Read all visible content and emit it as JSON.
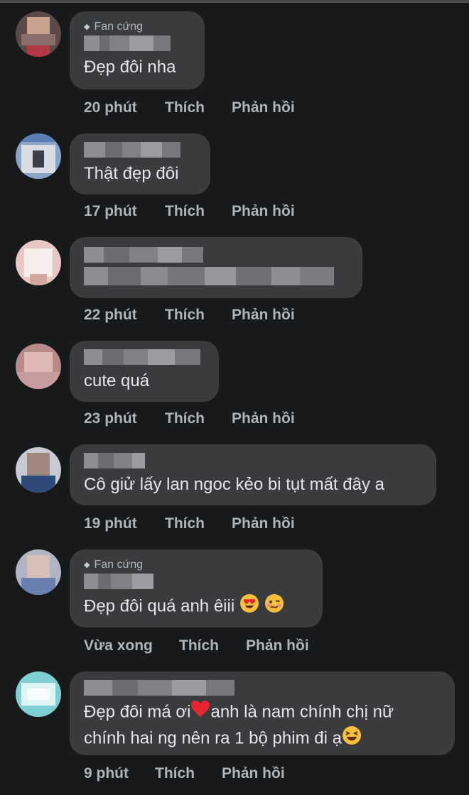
{
  "comments": [
    {
      "badge": "Fan cứng",
      "text": "Đẹp đôi nha",
      "time": "20 phút",
      "like": "Thích",
      "reply": "Phản hồi"
    },
    {
      "badge": "",
      "text": "Thật đẹp đôi",
      "time": "17 phút",
      "like": "Thích",
      "reply": "Phản hồi"
    },
    {
      "badge": "",
      "text": "",
      "time": "22 phút",
      "like": "Thích",
      "reply": "Phản hồi"
    },
    {
      "badge": "",
      "text": "cute quá",
      "time": "23 phút",
      "like": "Thích",
      "reply": "Phản hồi"
    },
    {
      "badge": "",
      "text": "Cô giử lấy lan ngoc kẻo bi tụt mất đây a",
      "time": "19 phút",
      "like": "Thích",
      "reply": "Phản hồi"
    },
    {
      "badge": "Fan cứng",
      "text": "Đẹp đôi quá anh êiii",
      "emojis": [
        "heart-eyes-emoji",
        "woozy-face-emoji"
      ],
      "time": "Vừa xong",
      "like": "Thích",
      "reply": "Phản hồi"
    },
    {
      "badge": "",
      "text_line1": "Đẹp đôi má ơi",
      "text_line1_after": "anh là nam chính chị nữ",
      "text_line2": "chính hai ng nên ra 1 bộ phim đi ạ",
      "emojis": [
        "red-heart-emoji",
        "laughing-face-emoji"
      ],
      "time": "9 phút",
      "like": "Thích",
      "reply": "Phản hồi"
    }
  ],
  "colors": {
    "background": "#18191a",
    "bubble": "#3a3b3c",
    "primary_text": "#e4e6eb",
    "secondary_text": "#b0b3b8"
  }
}
